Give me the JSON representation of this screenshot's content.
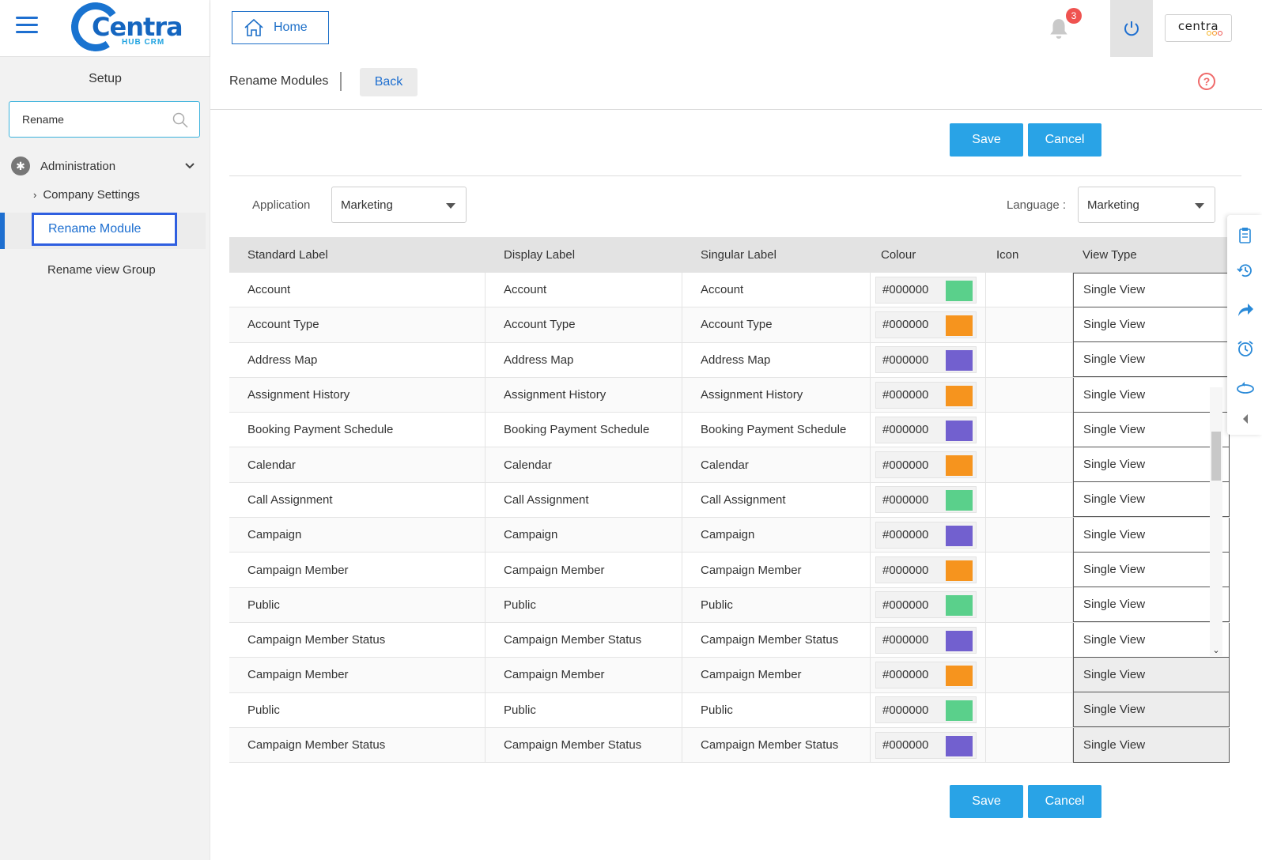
{
  "brand": {
    "logo_text": "Centra",
    "logo_sub": "HUB CRM",
    "badge_text": "centra"
  },
  "header": {
    "home_label": "Home",
    "notification_count": "3"
  },
  "sidebar": {
    "title": "Setup",
    "search_value": "Rename",
    "admin_label": "Administration",
    "company_settings_label": "Company Settings",
    "rename_module_label": "Rename Module",
    "rename_view_group_label": "Rename view Group"
  },
  "page": {
    "title": "Rename Modules",
    "back_label": "Back",
    "help_label": "?",
    "save_label": "Save",
    "cancel_label": "Cancel",
    "application_label": "Application",
    "application_value": "Marketing",
    "language_label": "Language",
    "language_value": "Marketing"
  },
  "table": {
    "headers": [
      "Standard Label",
      "Display Label",
      "Singular Label",
      "Colour",
      "Icon",
      "View Type"
    ],
    "rows": [
      {
        "standard": "Account",
        "display": "Account",
        "singular": "Account",
        "colour": "#000000",
        "swatch": "#5ad08b",
        "view": "Single View"
      },
      {
        "standard": "Account Type",
        "display": "Account Type",
        "singular": "Account Type",
        "colour": "#000000",
        "swatch": "#f6941e",
        "view": "Single View"
      },
      {
        "standard": "Address Map",
        "display": "Address Map",
        "singular": "Address Map",
        "colour": "#000000",
        "swatch": "#7260cf",
        "view": "Single View"
      },
      {
        "standard": "Assignment History",
        "display": "Assignment History",
        "singular": "Assignment History",
        "colour": "#000000",
        "swatch": "#f6941e",
        "view": "Single View"
      },
      {
        "standard": "Booking Payment Schedule",
        "display": "Booking Payment Schedule",
        "singular": "Booking Payment Schedule",
        "colour": "#000000",
        "swatch": "#7260cf",
        "view": "Single View"
      },
      {
        "standard": "Calendar",
        "display": "Calendar",
        "singular": "Calendar",
        "colour": "#000000",
        "swatch": "#f6941e",
        "view": "Single View"
      },
      {
        "standard": "Call Assignment",
        "display": "Call Assignment",
        "singular": "Call Assignment",
        "colour": "#000000",
        "swatch": "#5ad08b",
        "view": "Single View"
      },
      {
        "standard": "Campaign",
        "display": "Campaign",
        "singular": "Campaign",
        "colour": "#000000",
        "swatch": "#7260cf",
        "view": "Single View"
      },
      {
        "standard": "Campaign Member",
        "display": "Campaign Member",
        "singular": "Campaign Member",
        "colour": "#000000",
        "swatch": "#f6941e",
        "view": "Single View"
      },
      {
        "standard": "Public",
        "display": "Public",
        "singular": "Public",
        "colour": "#000000",
        "swatch": "#5ad08b",
        "view": "Single View"
      },
      {
        "standard": "Campaign Member Status",
        "display": "Campaign Member Status",
        "singular": "Campaign Member Status",
        "colour": "#000000",
        "swatch": "#7260cf",
        "view": "Single View"
      },
      {
        "standard": "Campaign Member",
        "display": "Campaign Member",
        "singular": "Campaign Member",
        "colour": "#000000",
        "swatch": "#f6941e",
        "view": "Single View"
      },
      {
        "standard": "Public",
        "display": "Public",
        "singular": "Public",
        "colour": "#000000",
        "swatch": "#5ad08b",
        "view": "Single View"
      },
      {
        "standard": "Campaign Member Status",
        "display": "Campaign Member Status",
        "singular": "Campaign Member Status",
        "colour": "#000000",
        "swatch": "#7260cf",
        "view": "Single View"
      }
    ]
  },
  "icons": {
    "right_toolbar": [
      "clipboard-icon",
      "history-icon",
      "share-icon",
      "alarm-icon",
      "360-view-icon",
      "collapse-arrow-icon"
    ]
  },
  "colors": {
    "accent": "#1e6fd0",
    "button": "#29a3e6",
    "badge": "#ef5350"
  }
}
